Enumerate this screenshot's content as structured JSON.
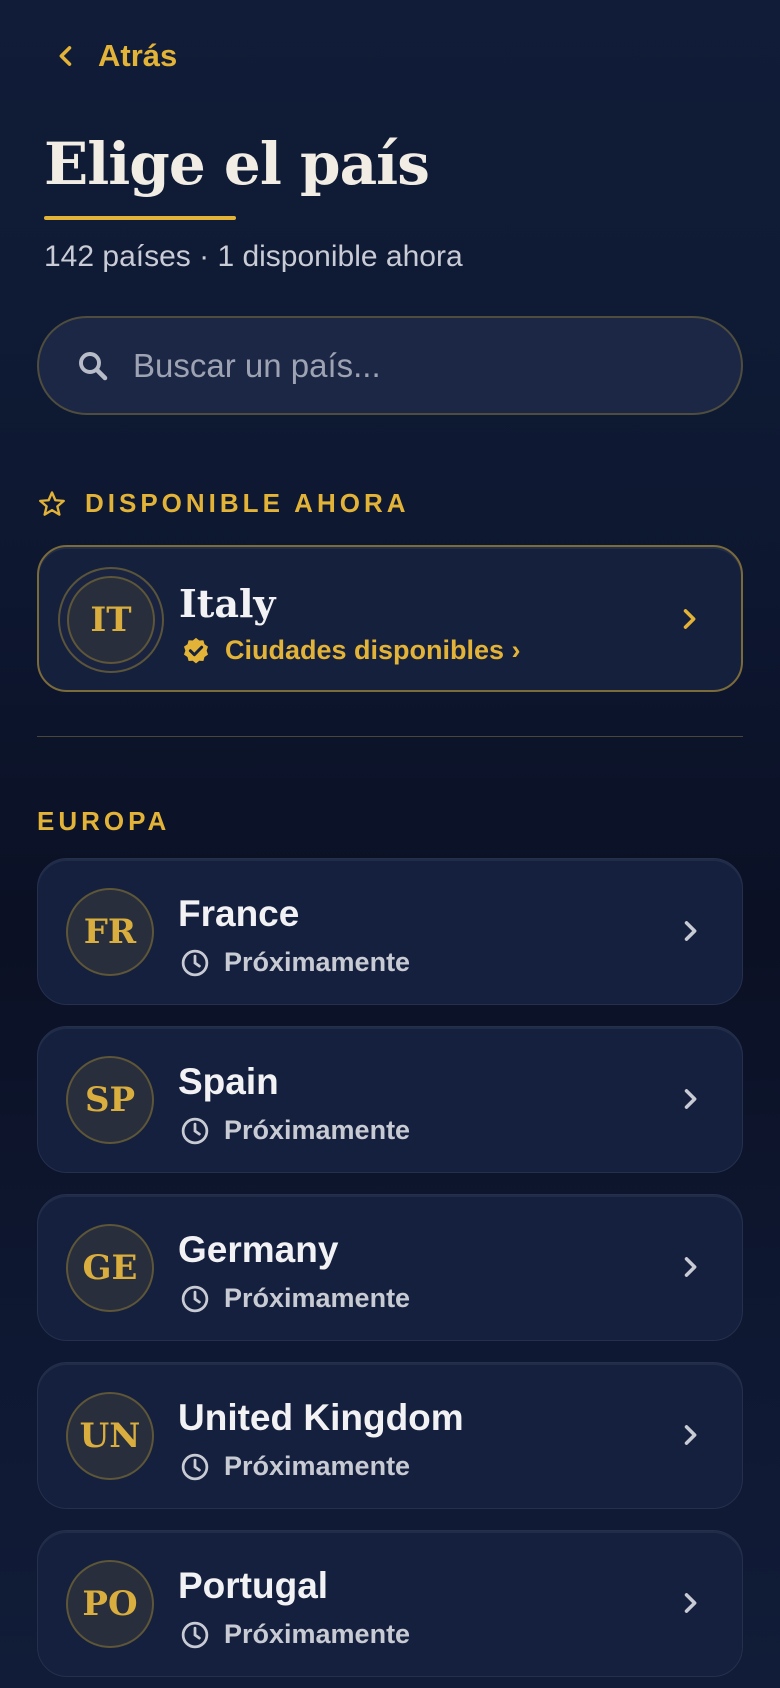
{
  "nav": {
    "back_label": "Atrás"
  },
  "header": {
    "title": "Elige el país",
    "subtitle": "142 países · 1 disponible ahora"
  },
  "search": {
    "placeholder": "Buscar un país..."
  },
  "available": {
    "section_label": "DISPONIBLE AHORA",
    "country": {
      "code": "IT",
      "name": "Italy",
      "status": "Ciudades disponibles ›"
    }
  },
  "europe": {
    "section_label": "EUROPA",
    "countries": [
      {
        "code": "FR",
        "name": "France",
        "status": "Próximamente"
      },
      {
        "code": "SP",
        "name": "Spain",
        "status": "Próximamente"
      },
      {
        "code": "GE",
        "name": "Germany",
        "status": "Próximamente"
      },
      {
        "code": "UN",
        "name": "United Kingdom",
        "status": "Próximamente"
      },
      {
        "code": "PO",
        "name": "Portugal",
        "status": "Próximamente"
      }
    ]
  },
  "colors": {
    "accent": "#e3b338",
    "background": "#0d1730",
    "card": "#14203d"
  },
  "icons": [
    "chevron-left-icon",
    "search-icon",
    "star-icon",
    "verified-icon",
    "clock-icon",
    "chevron-right-icon"
  ]
}
